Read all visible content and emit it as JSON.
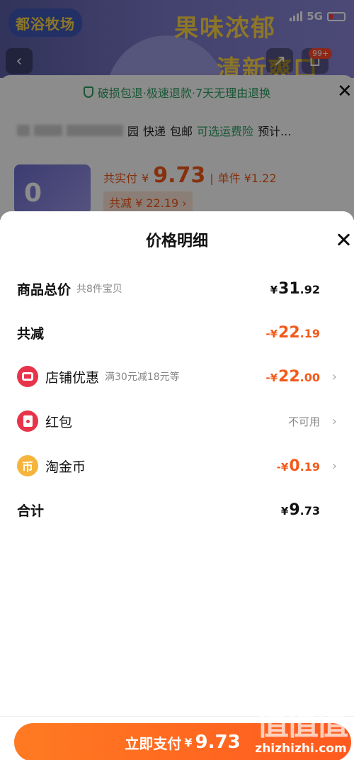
{
  "background": {
    "logo_text": "都浴牧场",
    "headline": "果味浓郁",
    "headline2": "清新爽口",
    "network": "5G",
    "cart_badge": "99+",
    "guarantee": "破损包退·极速退款·7天无理由退换",
    "delivery": {
      "suffix": "园",
      "express": "快递",
      "free": "包邮",
      "insurance": "可选运费险",
      "estimate": "预计..."
    },
    "thumb_text": "0",
    "pay_label": "共实付",
    "pay_yen": "¥",
    "pay_amount": "9.73",
    "sep": "|",
    "unit_price": "单件 ¥1.22",
    "reduce_tag": "共减 ¥ 22.19 ›"
  },
  "sheet": {
    "title": "价格明细",
    "rows": [
      {
        "label": "商品总价",
        "sub": "共8件宝贝",
        "yen": "¥",
        "int": "31",
        "dec": ".92"
      },
      {
        "label": "共减",
        "yen": "-¥",
        "int": "22",
        "dec": ".19"
      },
      {
        "label": "店铺优惠",
        "sub": "满30元减18元等",
        "yen": "-¥",
        "int": "22",
        "dec": ".00",
        "icon": "shop-icon"
      },
      {
        "label": "红包",
        "value_text": "不可用",
        "icon": "red-packet-icon"
      },
      {
        "label": "淘金币",
        "yen": "-¥",
        "int": "0",
        "dec": ".19",
        "icon": "coin-icon",
        "icon_glyph": "币"
      },
      {
        "label": "合计",
        "yen": "¥",
        "int": "9",
        "dec": ".73"
      }
    ],
    "chevron": "›"
  },
  "pay_button": {
    "label": "立即支付",
    "yen": "¥",
    "amount": "9.73"
  },
  "watermark": {
    "logo": "值值值",
    "url": "zhizhizhi.com"
  },
  "colors": {
    "accent": "#f25a1b",
    "green": "#2f9e63",
    "red_icon": "#e8344a",
    "coin": "#f5b43c"
  }
}
